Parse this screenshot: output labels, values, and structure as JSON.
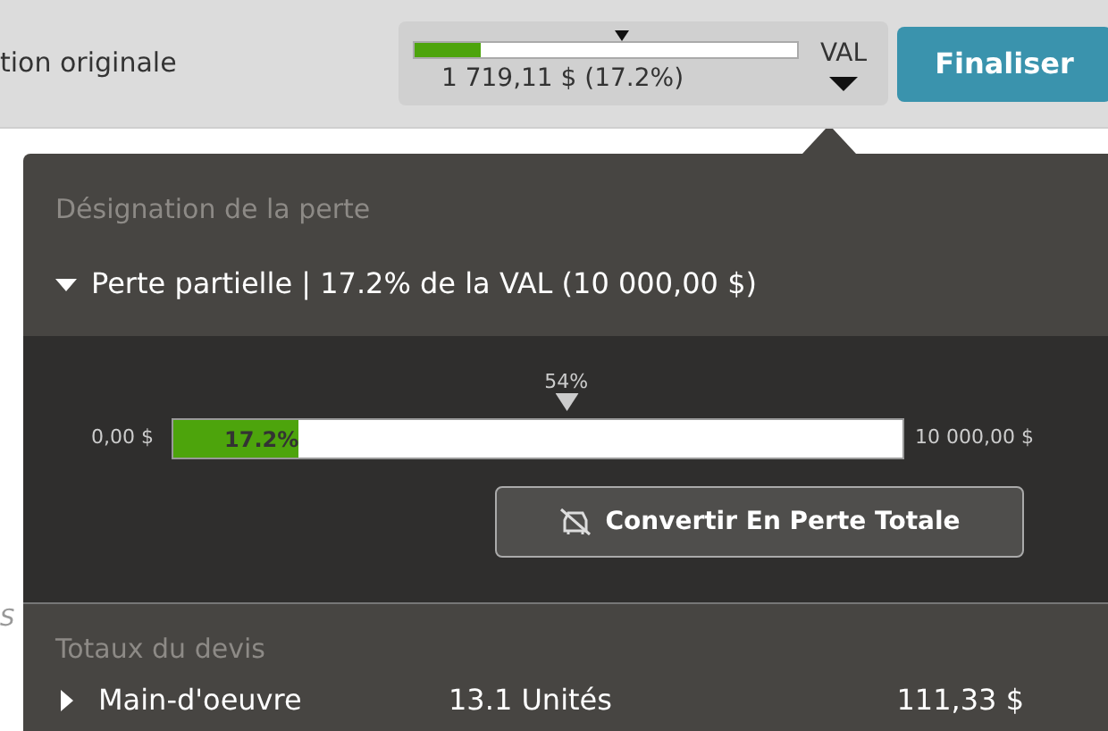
{
  "header": {
    "title": "tion originale",
    "meter": {
      "level": 0.172,
      "threshold": {
        "level": 0.54
      },
      "amount": "1 719,11 $ (17.2%)",
      "basis": "VAL"
    },
    "finalize_button": "Finaliser"
  },
  "background_text": "S",
  "popover": {
    "section_title": "Désignation de la perte",
    "loss": {
      "expanded": true,
      "label": "Perte partielle | 17.2% de la VAL (10 000,00 $)"
    },
    "gauge": {
      "min_label": "0,00 $",
      "max_label": "10 000,00 $",
      "level": 0.172,
      "fill_label": "17.2%",
      "threshold": {
        "label": "54%",
        "level": 0.54
      }
    },
    "convert_button": "Convertir En Perte Totale",
    "totals_title": "Totaux du devis",
    "totals": [
      {
        "expanded": false,
        "label": "Main-d'oeuvre",
        "quantity": "13.1 Unités",
        "amount": "111,33 $"
      }
    ]
  }
}
